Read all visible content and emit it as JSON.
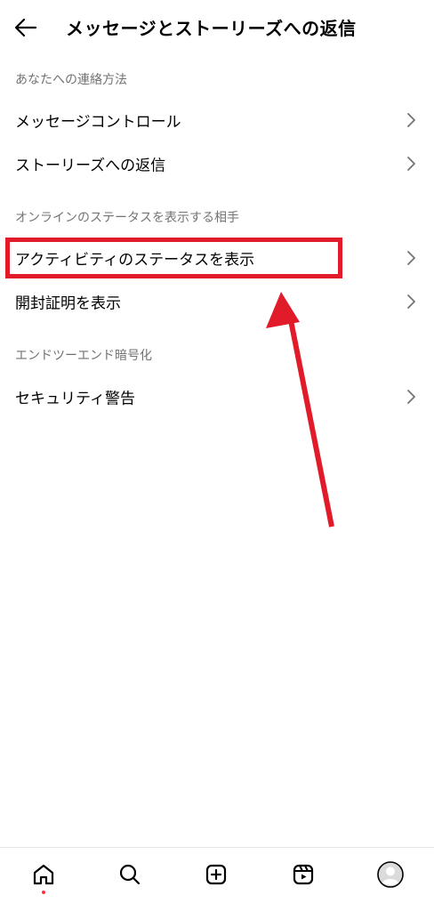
{
  "header": {
    "title": "メッセージとストーリーズへの返信",
    "back_icon": "arrow-left-icon"
  },
  "sections": [
    {
      "label": "あなたへの連絡方法",
      "items": [
        {
          "label": "メッセージコントロール"
        },
        {
          "label": "ストーリーズへの返信"
        }
      ]
    },
    {
      "label": "オンラインのステータスを表示する相手",
      "items": [
        {
          "label": "アクティビティのステータスを表示"
        },
        {
          "label": "開封証明を表示"
        }
      ]
    },
    {
      "label": "エンドツーエンド暗号化",
      "items": [
        {
          "label": "セキュリティ警告"
        }
      ]
    }
  ],
  "annotation": {
    "color": "#e21b2a",
    "highlighted_item": "アクティビティのステータスを表示"
  },
  "bottom_nav": {
    "items": [
      {
        "icon": "home-icon",
        "active": true
      },
      {
        "icon": "search-icon"
      },
      {
        "icon": "add-post-icon"
      },
      {
        "icon": "reels-icon"
      },
      {
        "icon": "profile-avatar-icon"
      }
    ],
    "notification_dot_color": "#ff3040"
  }
}
